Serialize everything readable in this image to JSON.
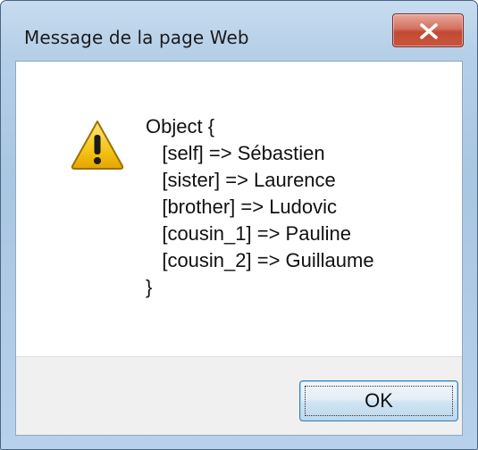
{
  "dialog": {
    "title": "Message de la page Web",
    "icon": "warning-icon",
    "message_lines": [
      "Object {",
      "   [self] => Sébastien",
      "   [sister] => Laurence",
      "   [brother] => Ludovic",
      "   [cousin_1] => Pauline",
      "   [cousin_2] => Guillaume",
      "}"
    ],
    "ok_label": "OK"
  },
  "colors": {
    "close_button": "#c9553c",
    "warning_fill": "#f5c518",
    "ok_border": "#3c7fb1"
  }
}
